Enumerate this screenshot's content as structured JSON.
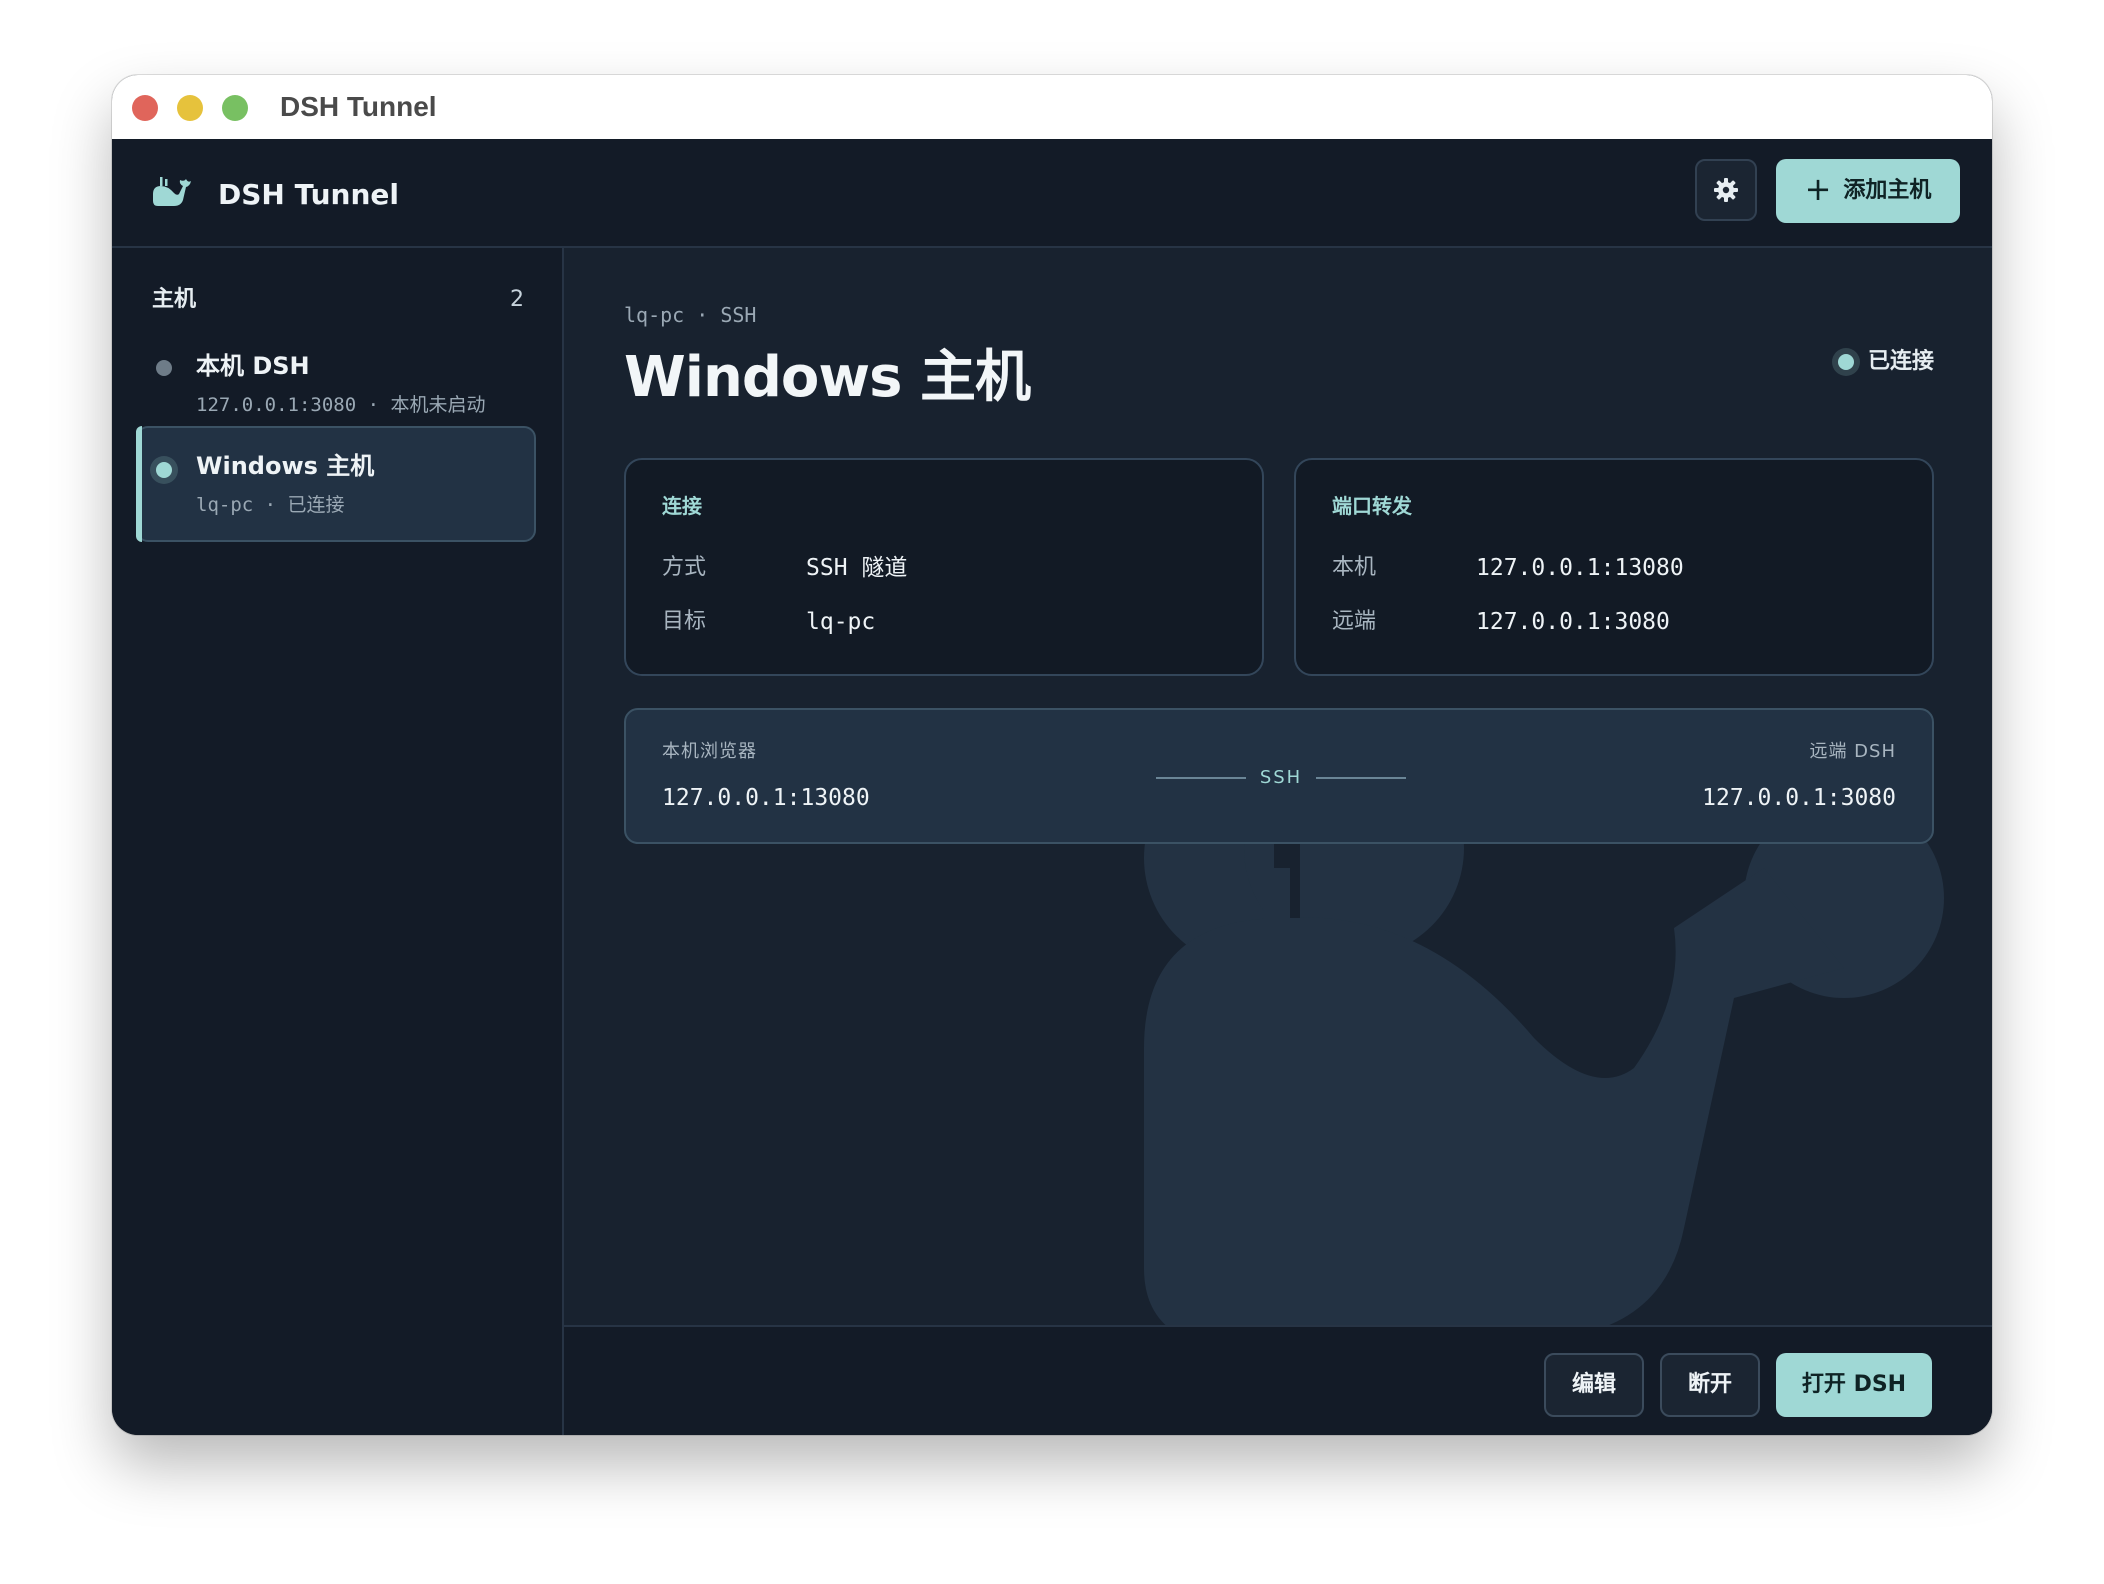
{
  "window": {
    "title": "DSH Tunnel"
  },
  "header": {
    "app_name": "DSH Tunnel",
    "add_host_label": "添加主机"
  },
  "sidebar": {
    "heading": "主机",
    "count": "2",
    "hosts": [
      {
        "name": "本机 DSH",
        "subtitle": "127.0.0.1:3080 · 本机未启动",
        "status": "offline"
      },
      {
        "name": "Windows 主机",
        "subtitle": "lq-pc · 已连接",
        "status": "connected"
      }
    ]
  },
  "main": {
    "breadcrumb": "lq-pc · SSH",
    "title": "Windows 主机",
    "status_label": "已连接",
    "connection": {
      "title": "连接",
      "rows": [
        {
          "key": "方式",
          "value": "SSH 隧道"
        },
        {
          "key": "目标",
          "value": "lq-pc"
        }
      ]
    },
    "forwarding": {
      "title": "端口转发",
      "rows": [
        {
          "key": "本机",
          "value": "127.0.0.1:13080"
        },
        {
          "key": "远端",
          "value": "127.0.0.1:3080"
        }
      ]
    },
    "route": {
      "left_label": "本机浏览器",
      "left_value": "127.0.0.1:13080",
      "middle_label": "SSH",
      "right_label": "远端 DSH",
      "right_value": "127.0.0.1:3080"
    }
  },
  "footer": {
    "edit_label": "编辑",
    "disconnect_label": "断开",
    "open_label": "打开 DSH"
  },
  "colors": {
    "accent": "#9fd8d5",
    "background": "#18222f",
    "sidebar": "#131b27",
    "card": "#121a25"
  },
  "icons": [
    "whale-icon",
    "gear-icon",
    "plus-icon",
    "status-dot-icon"
  ]
}
